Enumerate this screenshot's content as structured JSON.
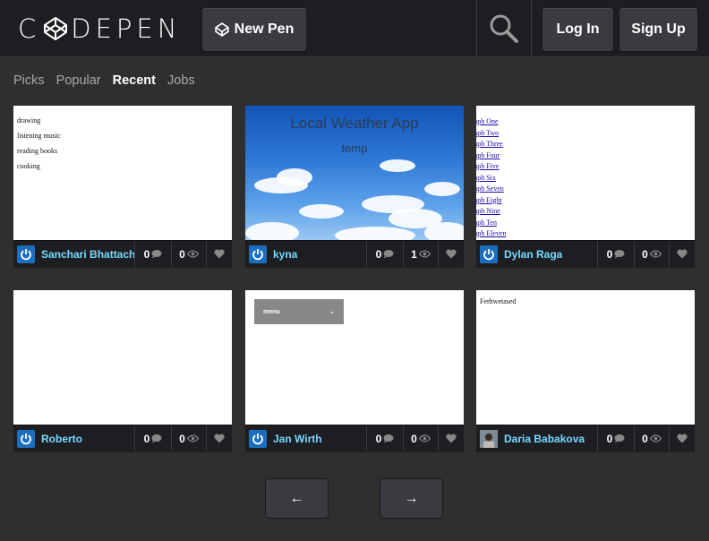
{
  "header": {
    "logo": "CODEPEN",
    "new_pen": "New Pen",
    "login": "Log In",
    "signup": "Sign Up"
  },
  "tabs": [
    "Picks",
    "Popular",
    "Recent",
    "Jobs"
  ],
  "active_tab": "Recent",
  "cards": [
    {
      "user": "Sanchari Bhattacharya",
      "comments": "0",
      "views": "0",
      "preview": {
        "lines": [
          "drawing",
          "listening music",
          "reading books",
          "cooking"
        ]
      }
    },
    {
      "user": "kyna",
      "comments": "0",
      "views": "1",
      "preview": {
        "title": "Local Weather App",
        "temp": "temp"
      }
    },
    {
      "user": "Dylan Raga",
      "comments": "0",
      "views": "0",
      "preview": {
        "links": [
          "raph One",
          "raph Two",
          "raph Three",
          "raph Four",
          "raph Five",
          "raph Six",
          "raph Seven",
          "raph Eight",
          "raph Nine",
          "raph Ten",
          "raph Eleven"
        ]
      }
    },
    {
      "user": "Roberto",
      "comments": "0",
      "views": "0",
      "preview": {}
    },
    {
      "user": "Jan Wirth",
      "comments": "0",
      "views": "0",
      "preview": {
        "menu": "menu",
        "caret": "⌄"
      }
    },
    {
      "user": "Daria Babakova",
      "comments": "0",
      "views": "0",
      "preview": {
        "text": "Ferhwetased"
      }
    }
  ],
  "pagination": {
    "prev": "←",
    "next": "→"
  },
  "colors": {
    "accent_username": "#76daff",
    "avatar_blue": "#1c6fbf",
    "header_bg": "#1d1e22",
    "page_bg": "#2f2f2f"
  },
  "icons": [
    "codepen-logo-icon",
    "search-icon",
    "comment-icon",
    "eye-icon",
    "heart-icon",
    "arrow-left-icon",
    "arrow-right-icon"
  ]
}
